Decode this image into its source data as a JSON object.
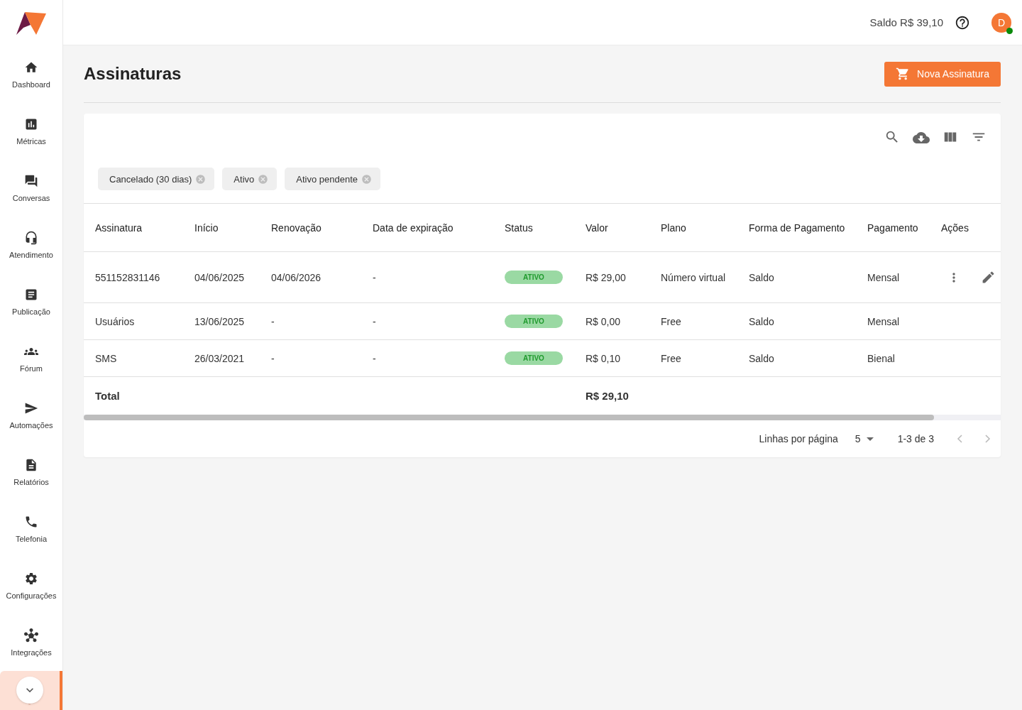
{
  "sidebar": {
    "items": [
      {
        "label": "Dashboard",
        "selected": false
      },
      {
        "label": "Métricas",
        "selected": false
      },
      {
        "label": "Conversas",
        "selected": false
      },
      {
        "label": "Atendimento",
        "selected": false
      },
      {
        "label": "Publicação",
        "selected": false
      },
      {
        "label": "Fórum",
        "selected": false
      },
      {
        "label": "Automações",
        "selected": false
      },
      {
        "label": "Relatórios",
        "selected": false
      },
      {
        "label": "Telefonia",
        "selected": false
      },
      {
        "label": "Configurações",
        "selected": false
      },
      {
        "label": "Integrações",
        "selected": false
      },
      {
        "selected": true
      }
    ]
  },
  "header": {
    "balance": "Saldo R$ 39,10",
    "avatar": "D",
    "online": true
  },
  "page": {
    "title": "Assinaturas",
    "new_button": "Nova Assinatura"
  },
  "filters": [
    "Cancelado (30 dias)",
    "Ativo",
    "Ativo pendente"
  ],
  "table": {
    "columns": [
      "Assinatura",
      "Início",
      "Renovação",
      "Data de expiração",
      "Status",
      "Valor",
      "Plano",
      "Forma de Pagamento",
      "Pagamento",
      "Ações"
    ],
    "rows": [
      {
        "cells": [
          "551152831146",
          "04/06/2025",
          "04/06/2026",
          "-",
          "ATIVO",
          "R$ 29,00",
          "Número virtual",
          "Saldo",
          "Mensal"
        ],
        "editable": true
      },
      {
        "cells": [
          "Usuários",
          "13/06/2025",
          "-",
          "-",
          "ATIVO",
          "R$ 0,00",
          "Free",
          "Saldo",
          "Mensal"
        ],
        "editable": false
      },
      {
        "cells": [
          "SMS",
          "26/03/2021",
          "-",
          "-",
          "ATIVO",
          "R$ 0,10",
          "Free",
          "Saldo",
          "Bienal"
        ],
        "editable": false
      }
    ],
    "total": {
      "label": "Total",
      "value": "R$ 29,10"
    }
  },
  "pagination": {
    "rows_label": "Linhas por página",
    "rows_per_page": "5",
    "range": "1-3 de 3"
  }
}
